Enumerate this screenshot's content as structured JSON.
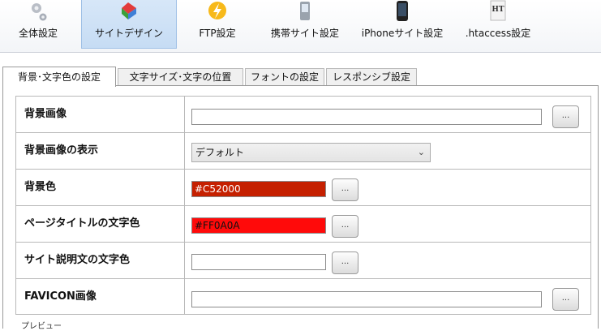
{
  "toolbar": {
    "items": [
      {
        "label": "全体設定",
        "icon": "gears-icon"
      },
      {
        "label": "サイトデザイン",
        "icon": "palette-icon",
        "active": true
      },
      {
        "label": "FTP設定",
        "icon": "lightning-icon"
      },
      {
        "label": "携帯サイト設定",
        "icon": "mobile-phone-icon"
      },
      {
        "label": "iPhoneサイト設定",
        "icon": "iphone-icon"
      },
      {
        "label": ".htaccess設定",
        "icon": "ht-document-icon"
      }
    ]
  },
  "tabs": [
    {
      "label": "背景･文字色の設定",
      "active": true
    },
    {
      "label": "文字サイズ･文字の位置"
    },
    {
      "label": "フォントの設定"
    },
    {
      "label": "レスポンシブ設定"
    }
  ],
  "form": {
    "rows": [
      {
        "label": "背景画像",
        "value": "",
        "button": "..."
      },
      {
        "label": "背景画像の表示",
        "select_value": "デフォルト"
      },
      {
        "label": "背景色",
        "value": "#C52000",
        "color": "#C52000",
        "button": "..."
      },
      {
        "label": "ページタイトルの文字色",
        "value": "#FF0A0A",
        "color": "#FF0A0A",
        "button": "..."
      },
      {
        "label": "サイト説明文の文字色",
        "value": "",
        "button": "..."
      },
      {
        "label": "FAVICON画像",
        "value": "",
        "button": "..."
      }
    ]
  },
  "preview": {
    "label": "プレビュー"
  },
  "colors": {
    "active_tool_bg": "#C6DCF4",
    "border": "#B9B9B9"
  }
}
